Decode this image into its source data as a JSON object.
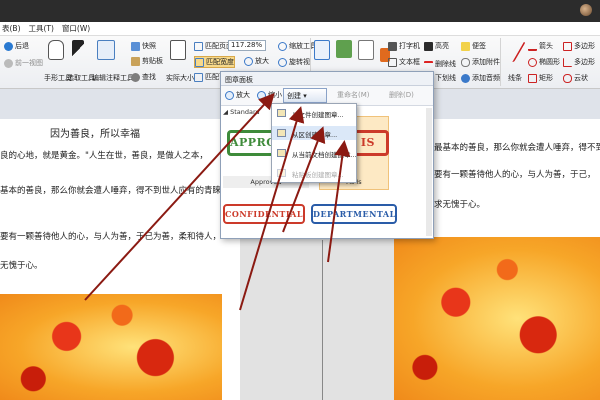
{
  "menubar": {
    "items": [
      "表(B)",
      "工具(T)",
      "窗口(W)"
    ]
  },
  "ribbon": {
    "back": "后退",
    "recent": "前一视图",
    "hand_tool": "手形工具",
    "select_tool": "选取工具",
    "annotate_tool": "编辑注释工具",
    "snapshot": "快照",
    "clipboard": "剪贴板",
    "find": "查找",
    "actual_size": "实际大小",
    "fit_page": "匹配页面",
    "fit_width": "匹配宽度",
    "fit_visible": "匹配可",
    "zoom_value": "117.28%",
    "zoom_in": "放大",
    "zoom_out": "缩放工具",
    "rotate_view": "旋转视",
    "typewriter": "打字机",
    "textbox": "文本框",
    "highlight": "高亮",
    "strikeout": "删除线",
    "underline": "下划线",
    "note": "便签",
    "add_file": "添加附件",
    "add_audio": "添加音频",
    "arrow": "箭头",
    "line": "线条",
    "rectangle": "矩形",
    "polygon": "多边形",
    "ellipse": "椭圆形",
    "polyline": "多边形",
    "cloud": "云状"
  },
  "panel": {
    "title": "图章面板",
    "zoom_in": "放大",
    "zoom_out": "缩小",
    "create": "创建",
    "rename": "重命名(M)",
    "delete": "删除(D)",
    "category": "Standard",
    "stamps": [
      {
        "text": "APPROVED",
        "label": "Approved"
      },
      {
        "text": "AS IS",
        "label": "As Is"
      },
      {
        "text": "CONFIDENTIAL",
        "label": ""
      },
      {
        "text": "DEPARTMENTAL",
        "label": ""
      }
    ]
  },
  "menu": {
    "items": [
      "从文件创建图章...",
      "从区创建图章...",
      "从当前文档创建图章...",
      "粘贴板创建图章..."
    ]
  },
  "doc_left": {
    "heading": "因为善良，所以幸福",
    "lines": [
      "良的心地，就是黄金。\"人生在世，善良，是做人之本，",
      "基本的善良，那么你就会遭人唾弃，得不到世人应有的青睐",
      "要有一颗善待他人的心，与人为善，于己为善，柔和待人，",
      "无愧于心。"
    ]
  },
  "doc_right": {
    "lines": [
      "最基本的善良，那么你就会遭人唾弃，得不到",
      "要有一颗善待他人的心，与人为善，于己，",
      "求无愧于心。"
    ]
  },
  "colors": {
    "annotation_arrow": "#8b1a12",
    "approved": "#3e8b3a",
    "asis": "#cc3a2a",
    "departmental": "#2a5ca8"
  }
}
